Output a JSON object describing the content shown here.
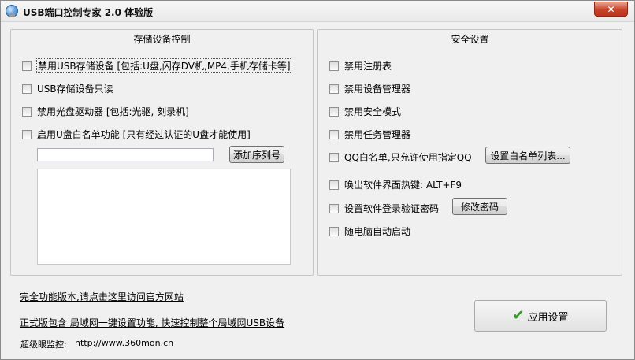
{
  "window": {
    "title": "USB端口控制专家 2.0 体验版",
    "close_label": "✕"
  },
  "storage_group": {
    "title": "存储设备控制",
    "options": [
      "禁用USB存储设备 [包括:U盘,闪存DV机,MP4,手机存储卡等]",
      "USB存储设备只读",
      "禁用光盘驱动器 [包括:光驱, 刻录机]",
      "启用U盘白名单功能 [只有经过认证的U盘才能使用]"
    ],
    "serial_input_value": "",
    "add_serial_button": "添加序列号"
  },
  "security_group": {
    "title": "安全设置",
    "options": [
      "禁用注册表",
      "禁用设备管理器",
      "禁用安全模式",
      "禁用任务管理器",
      "QQ白名单,只允许使用指定QQ",
      "唤出软件界面热键: ALT+F9",
      "设置软件登录验证密码",
      "随电脑自动启动"
    ],
    "whitelist_button": "设置白名单列表...",
    "change_password_button": "修改密码"
  },
  "footer": {
    "full_version_link": "完全功能版本,请点击这里访问官方网站",
    "lan_feature_link": "正式版包含 局域网一键设置功能, 快速控制整个局域网USB设备",
    "monitor_label": "超级眼监控:",
    "monitor_url": "http://www.360mon.cn"
  },
  "apply_button": "应用设置",
  "icons": {
    "app": "usb-globe-icon",
    "close": "close-icon",
    "apply": "checkmark-icon"
  }
}
